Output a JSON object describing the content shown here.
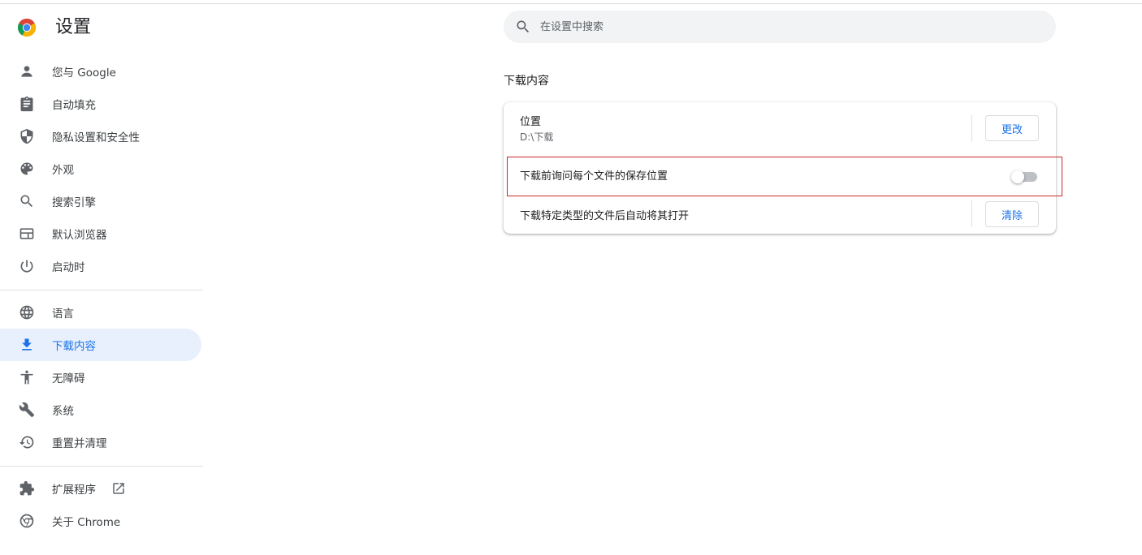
{
  "app": {
    "title": "设置"
  },
  "search": {
    "placeholder": "在设置中搜索",
    "value": ""
  },
  "sidebar": {
    "items": [
      {
        "label": "您与 Google",
        "icon": "person-icon"
      },
      {
        "label": "自动填充",
        "icon": "clipboard-icon"
      },
      {
        "label": "隐私设置和安全性",
        "icon": "shield-icon"
      },
      {
        "label": "外观",
        "icon": "palette-icon"
      },
      {
        "label": "搜索引擎",
        "icon": "search-icon"
      },
      {
        "label": "默认浏览器",
        "icon": "browser-window-icon"
      },
      {
        "label": "启动时",
        "icon": "power-icon"
      },
      {
        "label": "语言",
        "icon": "globe-icon"
      },
      {
        "label": "下载内容",
        "icon": "download-icon",
        "active": true
      },
      {
        "label": "无障碍",
        "icon": "accessibility-icon"
      },
      {
        "label": "系统",
        "icon": "wrench-icon"
      },
      {
        "label": "重置并清理",
        "icon": "restore-icon"
      },
      {
        "label": "扩展程序",
        "icon": "puzzle-icon"
      },
      {
        "label": "关于 Chrome",
        "icon": "chrome-icon"
      }
    ]
  },
  "downloads": {
    "section_title": "下载内容",
    "location_label": "位置",
    "location_value": "D:\\下载",
    "change_button": "更改",
    "ask_label": "下载前询问每个文件的保存位置",
    "ask_enabled": false,
    "auto_open_label": "下载特定类型的文件后自动将其打开",
    "clear_button": "清除"
  },
  "colors": {
    "accent": "#1a73e8",
    "active_bg": "#e8f0fe",
    "highlight_border": "#c62828"
  }
}
